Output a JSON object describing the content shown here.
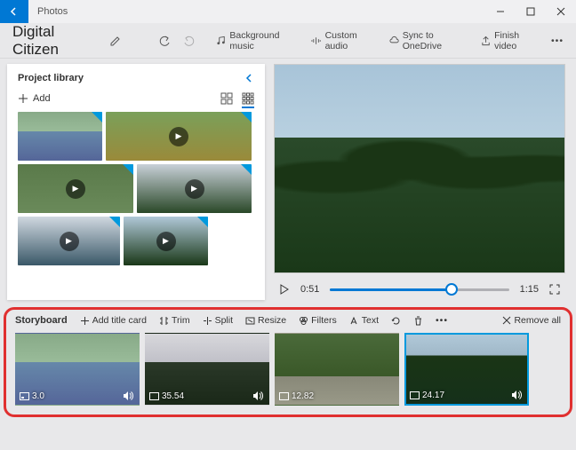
{
  "app": {
    "name": "Photos"
  },
  "project": {
    "title": "Digital Citizen"
  },
  "header_actions": {
    "bg_music": "Background music",
    "custom_audio": "Custom audio",
    "sync": "Sync to OneDrive",
    "finish": "Finish video"
  },
  "library": {
    "title": "Project library",
    "add": "Add"
  },
  "player": {
    "current_time": "0:51",
    "duration": "1:15"
  },
  "storyboard": {
    "title": "Storyboard",
    "add_title_card": "Add title card",
    "trim": "Trim",
    "split": "Split",
    "resize": "Resize",
    "filters": "Filters",
    "text": "Text",
    "remove_all": "Remove all",
    "clips": [
      {
        "duration": "3.0",
        "has_audio": true,
        "selected": false
      },
      {
        "duration": "35.54",
        "has_audio": true,
        "selected": false
      },
      {
        "duration": "12.82",
        "has_audio": false,
        "selected": false
      },
      {
        "duration": "24.17",
        "has_audio": true,
        "selected": true
      }
    ]
  }
}
